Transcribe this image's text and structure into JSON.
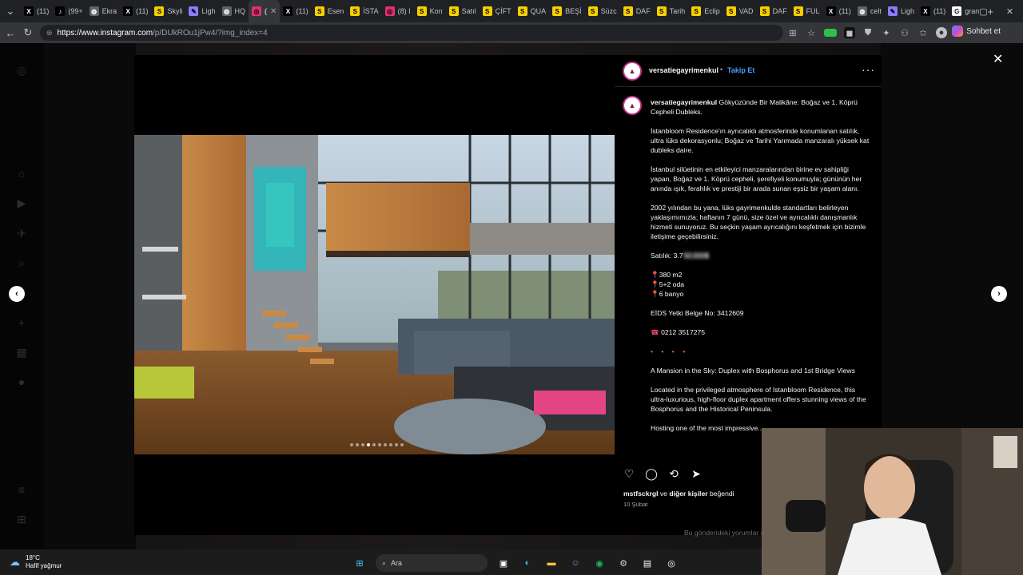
{
  "browser": {
    "tabs": [
      {
        "label": "(11)",
        "icon": "x-icon",
        "color": "#000000",
        "glyph": "X"
      },
      {
        "label": "(99+",
        "icon": "tiktok-icon",
        "color": "#000000",
        "glyph": "♪"
      },
      {
        "label": "Ekra",
        "icon": "globe-icon",
        "color": "#5f6368",
        "glyph": "◍"
      },
      {
        "label": "(11)",
        "icon": "x-icon",
        "color": "#000000",
        "glyph": "X"
      },
      {
        "label": "Skyli",
        "icon": "s-icon",
        "color": "#f4d000",
        "glyph": "S"
      },
      {
        "label": "Ligh",
        "icon": "pen-icon",
        "color": "#8a7cff",
        "glyph": "✎"
      },
      {
        "label": "HQ",
        "icon": "globe-icon",
        "color": "#5f6368",
        "glyph": "◍"
      },
      {
        "label": "(",
        "icon": "instagram-icon",
        "color": "#e1306c",
        "glyph": "◎",
        "active": true
      },
      {
        "label": "(11)",
        "icon": "x-icon",
        "color": "#000000",
        "glyph": "X"
      },
      {
        "label": "Esen",
        "icon": "s-icon",
        "color": "#f4d000",
        "glyph": "S"
      },
      {
        "label": "İSTA",
        "icon": "s-icon",
        "color": "#f4d000",
        "glyph": "S"
      },
      {
        "label": "(8) I",
        "icon": "instagram-icon",
        "color": "#e1306c",
        "glyph": "◎"
      },
      {
        "label": "Kon",
        "icon": "s-icon",
        "color": "#f4d000",
        "glyph": "S"
      },
      {
        "label": "Satıl",
        "icon": "s-icon",
        "color": "#f4d000",
        "glyph": "S"
      },
      {
        "label": "ÇİFT",
        "icon": "s-icon",
        "color": "#f4d000",
        "glyph": "S"
      },
      {
        "label": "QUA",
        "icon": "s-icon",
        "color": "#f4d000",
        "glyph": "S"
      },
      {
        "label": "BEŞİ",
        "icon": "s-icon",
        "color": "#f4d000",
        "glyph": "S"
      },
      {
        "label": "Süzc",
        "icon": "s-icon",
        "color": "#f4d000",
        "glyph": "S"
      },
      {
        "label": "DAF",
        "icon": "s-icon",
        "color": "#f4d000",
        "glyph": "S"
      },
      {
        "label": "Tarih",
        "icon": "s-icon",
        "color": "#f4d000",
        "glyph": "S"
      },
      {
        "label": "Eclip",
        "icon": "s-icon",
        "color": "#f4d000",
        "glyph": "S"
      },
      {
        "label": "VAD",
        "icon": "s-icon",
        "color": "#f4d000",
        "glyph": "S"
      },
      {
        "label": "DAF",
        "icon": "s-icon",
        "color": "#f4d000",
        "glyph": "S"
      },
      {
        "label": "FUL",
        "icon": "s-icon",
        "color": "#f4d000",
        "glyph": "S"
      },
      {
        "label": "(11)",
        "icon": "x-icon",
        "color": "#000000",
        "glyph": "X"
      },
      {
        "label": "celt",
        "icon": "globe-icon",
        "color": "#5f6368",
        "glyph": "◍"
      },
      {
        "label": "Ligh",
        "icon": "pen-icon",
        "color": "#8a7cff",
        "glyph": "✎"
      },
      {
        "label": "(11)",
        "icon": "x-icon",
        "color": "#000000",
        "glyph": "X"
      },
      {
        "label": "gran",
        "icon": "google-icon",
        "color": "#ffffff",
        "glyph": "G"
      }
    ],
    "url_host": "https://www.instagram.com",
    "url_path": "/p/DUkROu1jPw4/?img_index=4",
    "chat_label": "Sohbet et"
  },
  "post": {
    "username": "versatiegayrimenkul",
    "follow_label": "Takip Et",
    "separator": "•",
    "caption": {
      "title": "Gökyüzünde Bir Malikâne: Boğaz ve 1. Köprü Cepheli Dubleks.",
      "p1": "İstanbloom Residence'ın ayrıcalıklı atmosferinde konumlanan satılık, ultra lüks dekorasyonlu; Boğaz ve Tarihi Yarımada manzaralı yüksek kat dubleks daire.",
      "p2": "İstanbul silüetinin en etkileyici manzaralarından birine ev sahipliği yapan, Boğaz ve 1. Köprü cepheli, şerefiyeli konumuyla; gününün her anında ışık, ferahlık ve prestiji bir arada sunan eşsiz bir yaşam alanı.",
      "p3": "2002 yılından bu yana, lüks gayrimenkulde standartları belirleyen yaklaşımımızla; haftanın 7 günü, size özel ve ayrıcalıklı danışmanlık hizmeti sunuyoruz. Bu seçkin yaşam ayrıcalığını keşfetmek için bizimle iletişime geçebilirsiniz.",
      "price_label": "Satılık: 3.7",
      "price_hidden": "50.000$",
      "area": "380 m2",
      "rooms": "5+2 oda",
      "baths": "6 banyo",
      "license": "EİDS Yetki Belge No: 3412609",
      "phone": "0212 3517275",
      "sparkles": "• • • •",
      "en_title": "A Mansion in the Sky: Duplex with Bosphorus and 1st Bridge Views",
      "en_p1": "Located in the privileged atmosphere of Istanbloom Residence, this ultra-luxurious, high-floor duplex apartment offers stunning views of the Bosphorus and the Historical Peninsula.",
      "en_p2": "Hosting one of the most impressive..."
    },
    "likes_user": "mstfsckrgl",
    "likes_rest": " ve ",
    "likes_others": "diğer kişiler",
    "likes_suffix": " beğendi",
    "date": "10 Şubat",
    "comments_limited": "Bu gönderideki yorumlar sınırlandırıldı."
  },
  "taskbar": {
    "temp": "18°C",
    "weather": "Hafif yağmur",
    "search_placeholder": "Ara"
  }
}
